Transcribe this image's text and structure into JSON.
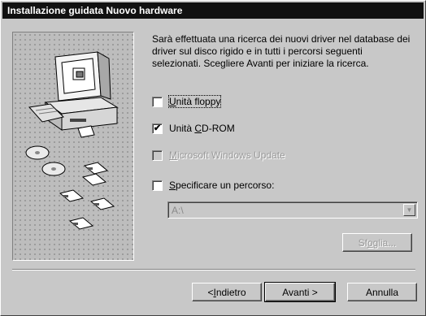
{
  "window": {
    "title": "Installazione guidata Nuovo hardware"
  },
  "intro_text": "Sarà effettuata una ricerca dei nuovi driver nel database dei driver sul disco rigido e in tutti i percorsi seguenti selezionati. Scegliere Avanti per iniziare la ricerca.",
  "options": [
    {
      "pre": "",
      "key": "U",
      "post": "nità floppy",
      "checked": false,
      "enabled": true
    },
    {
      "pre": "Unità ",
      "key": "C",
      "post": "D-ROM",
      "checked": true,
      "enabled": true
    },
    {
      "pre": "",
      "key": "M",
      "post": "icrosoft Windows Update",
      "checked": false,
      "enabled": false
    },
    {
      "pre": "",
      "key": "S",
      "post": "pecificare un percorso:",
      "checked": false,
      "enabled": true
    }
  ],
  "path_field": {
    "value": "A:\\",
    "enabled": false
  },
  "browse_button": {
    "pre": "Sf",
    "key": "o",
    "post": "glia...",
    "enabled": false
  },
  "buttons": {
    "back": {
      "pre": "< ",
      "key": "I",
      "post": "ndietro"
    },
    "next": {
      "label": "Avanti >"
    },
    "cancel": {
      "label": "Annulla"
    }
  },
  "colors": {
    "title_bar": "#111111",
    "face": "#c8c8c8"
  }
}
